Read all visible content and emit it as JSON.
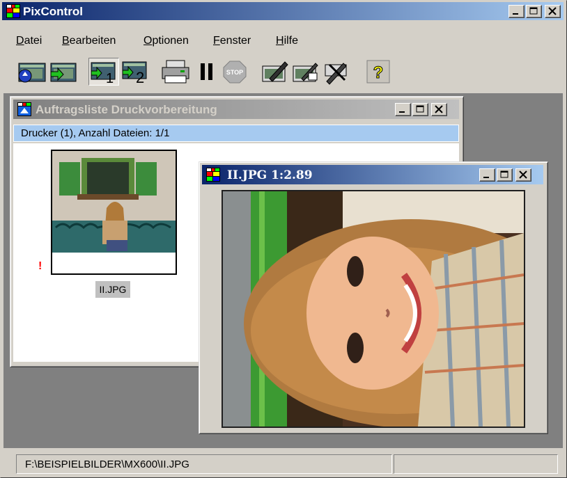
{
  "app": {
    "title": "PixControl"
  },
  "menu": [
    {
      "label": "Datei",
      "mnemonic": "D",
      "rest": "atei"
    },
    {
      "label": "Bearbeiten",
      "mnemonic": "B",
      "rest": "earbeiten"
    },
    {
      "label": "Optionen",
      "mnemonic": "O",
      "rest": "ptionen"
    },
    {
      "label": "Fenster",
      "mnemonic": "F",
      "rest": "enster"
    },
    {
      "label": "Hilfe",
      "mnemonic": "H",
      "rest": "ilfe"
    }
  ],
  "toolbar": {
    "buttons": [
      {
        "name": "open-file-icon"
      },
      {
        "name": "add-file-icon"
      },
      {
        "name": "printer-1-icon",
        "badge": "1"
      },
      {
        "name": "printer-2-icon",
        "badge": "2"
      },
      {
        "name": "print-icon"
      },
      {
        "name": "pause-icon"
      },
      {
        "name": "stop-icon",
        "text": "STOP"
      },
      {
        "name": "edit-image-icon"
      },
      {
        "name": "edit-image-2-icon"
      },
      {
        "name": "tools-icon"
      },
      {
        "name": "help-icon",
        "text": "?"
      }
    ]
  },
  "job_window": {
    "title": "Auftragsliste Druckvorbereitung",
    "header": "Drucker (1), Anzahl Dateien: 1/1",
    "items": [
      {
        "filename": "II.JPG",
        "warning": "!"
      }
    ]
  },
  "image_window": {
    "title": "II.JPG 1:2.89"
  },
  "statusbar": {
    "path": "F:\\BEISPIELBILDER\\MX600\\II.JPG",
    "right": ""
  },
  "colors": {
    "active_title_start": "#0a246a",
    "active_title_end": "#a6caf0",
    "inactive_title": "#808080",
    "list_header": "#a6caf0",
    "mdi_background": "#808080",
    "warning": "#ff0000"
  }
}
